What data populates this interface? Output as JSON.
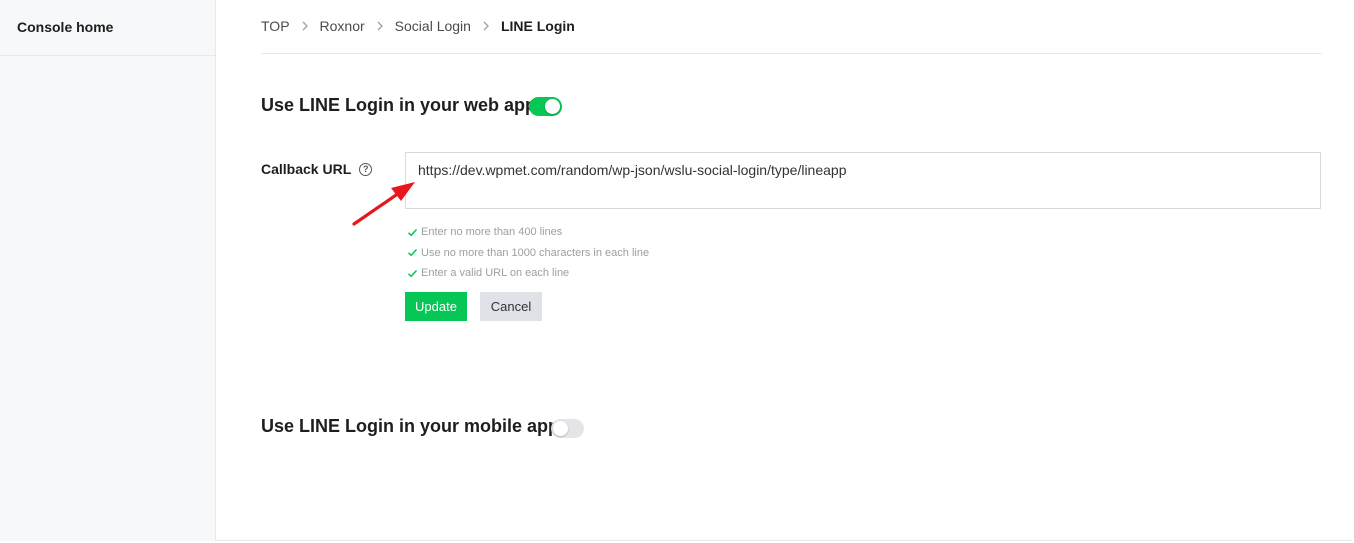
{
  "sidebar": {
    "home_label": "Console home"
  },
  "breadcrumb": {
    "items": [
      "TOP",
      "Roxnor",
      "Social Login",
      "LINE Login"
    ]
  },
  "web_app": {
    "title": "Use LINE Login in your web app",
    "enabled": true,
    "callback_label": "Callback URL",
    "callback_value": "https://dev.wpmet.com/random/wp-json/wslu-social-login/type/lineapp",
    "rules": [
      "Enter no more than 400 lines",
      "Use no more than 1000 characters in each line",
      "Enter a valid URL on each line"
    ],
    "update_label": "Update",
    "cancel_label": "Cancel"
  },
  "mobile_app": {
    "title": "Use LINE Login in your mobile app",
    "enabled": false
  },
  "colors": {
    "accent": "#06c755",
    "annotation_arrow": "#e8171b"
  },
  "icons": {
    "help": "question-circle-icon",
    "check": "check-icon",
    "separator": "chevron-right-icon"
  }
}
